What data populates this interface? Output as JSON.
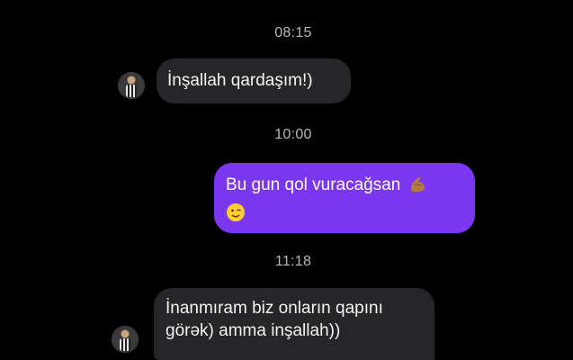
{
  "conversation": {
    "timestamps": [
      "08:15",
      "10:00",
      "11:18"
    ],
    "messages": [
      {
        "direction": "incoming",
        "text": "İnşallah qardaşım!)",
        "emoji": []
      },
      {
        "direction": "outgoing",
        "text": "Bu gun qol vuracağsan",
        "emoji": [
          "flexed-biceps-icon",
          "winking-face-icon"
        ]
      },
      {
        "direction": "incoming",
        "text_line1": "İnanmıram biz onların qapını",
        "text_line2": "görək) amma inşallah))",
        "emoji": []
      }
    ]
  },
  "colors": {
    "background": "#000000",
    "incoming_bubble": "#262628",
    "outgoing_bubble": "#7b36f0",
    "timestamp_text": "#b8b8b8"
  }
}
